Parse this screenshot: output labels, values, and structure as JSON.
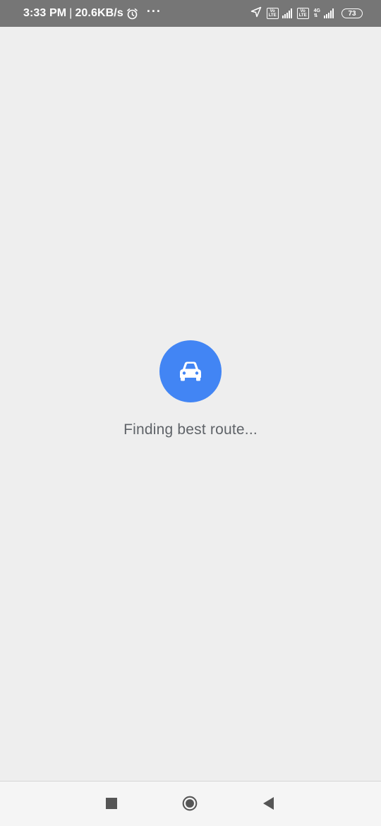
{
  "status_bar": {
    "time": "3:33 PM",
    "separator": "|",
    "net_speed": "20.6KB/s",
    "more": "···",
    "volte_1": [
      "Vo",
      "LTE"
    ],
    "volte_2": [
      "Vo",
      "LTE"
    ],
    "net_type": "4G",
    "battery": "73"
  },
  "loading": {
    "icon": "car-icon",
    "message": "Finding best route...",
    "accent_color": "#4285f4"
  },
  "nav_bar": {
    "recents": "square-icon",
    "home": "circle-home-icon",
    "back": "triangle-back-icon"
  }
}
